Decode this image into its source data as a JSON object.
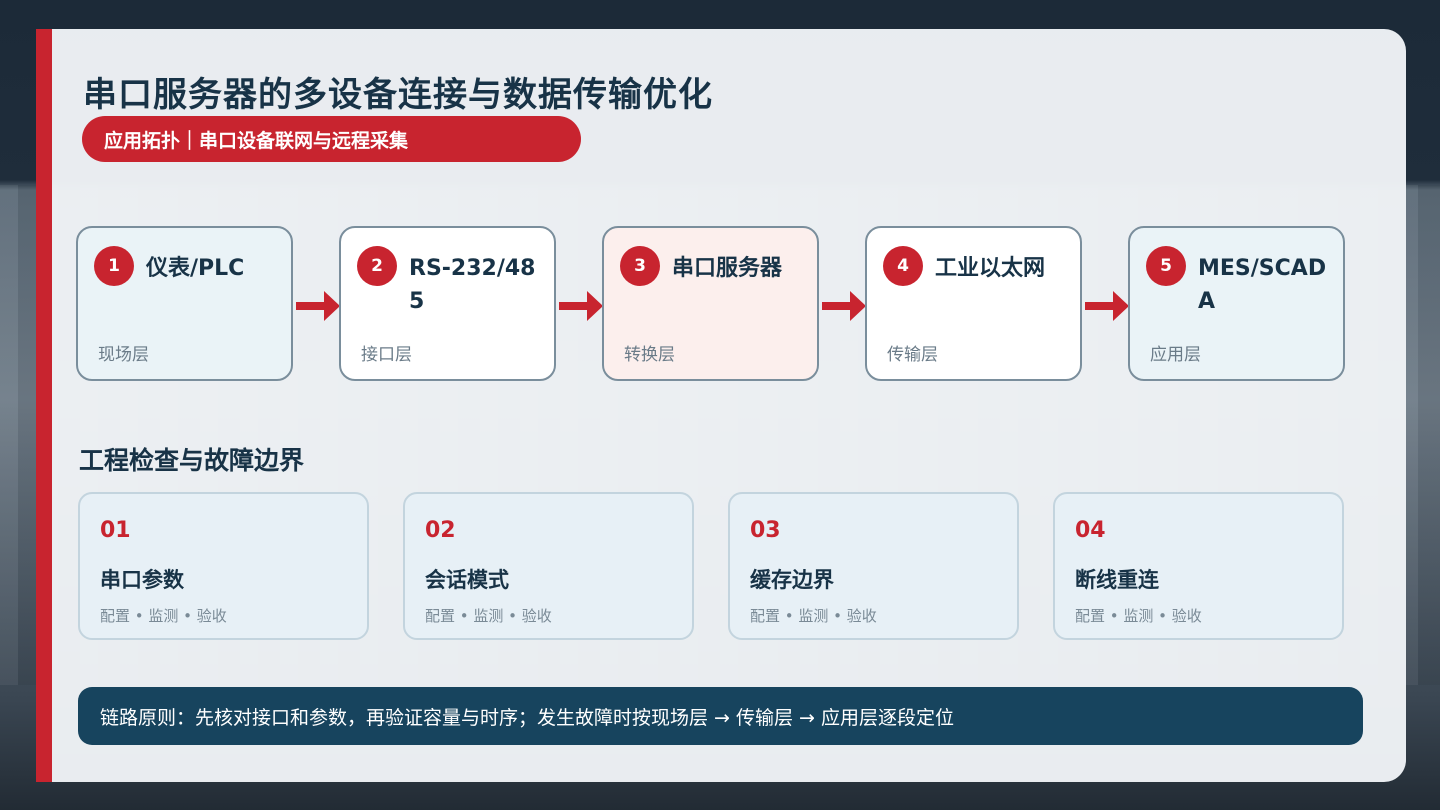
{
  "title": "串口服务器的多设备连接与数据传输优化",
  "subtitle": "应用拓扑｜串口设备联网与远程采集",
  "flow": [
    {
      "num": "1",
      "title": "仪表/PLC",
      "layer": "现场层"
    },
    {
      "num": "2",
      "title": "RS-232/485",
      "layer": "接口层"
    },
    {
      "num": "3",
      "title": "串口服务器",
      "layer": "转换层"
    },
    {
      "num": "4",
      "title": "工业以太网",
      "layer": "传输层"
    },
    {
      "num": "5",
      "title": "MES/SCADA",
      "layer": "应用层"
    }
  ],
  "section_title": "工程检查与故障边界",
  "checks": [
    {
      "num": "01",
      "title": "串口参数",
      "tags": "配置 • 监测 • 验收"
    },
    {
      "num": "02",
      "title": "会话模式",
      "tags": "配置 • 监测 • 验收"
    },
    {
      "num": "03",
      "title": "缓存边界",
      "tags": "配置 • 监测 • 验收"
    },
    {
      "num": "04",
      "title": "断线重连",
      "tags": "配置 • 监测 • 验收"
    }
  ],
  "footer": "链路原则：先核对接口和参数，再验证容量与时序；发生故障时按现场层 → 传输层 → 应用层逐段定位",
  "colors": {
    "accent": "#c8242f",
    "navy": "#183347",
    "footer_bg": "#17445e"
  }
}
